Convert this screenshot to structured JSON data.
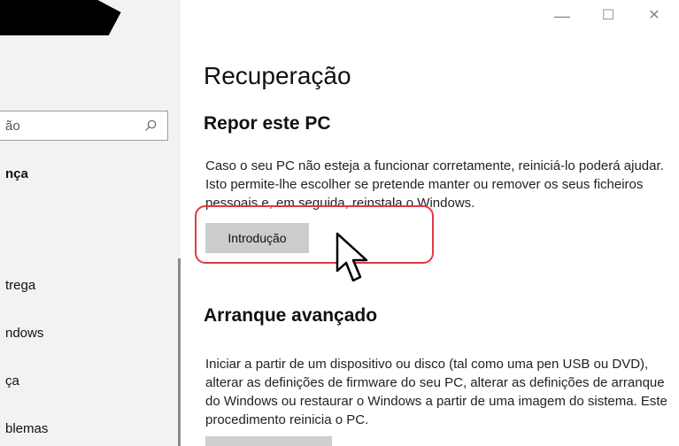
{
  "window": {
    "minimize": "—",
    "maximize": "☐",
    "close": "✕"
  },
  "sidebar": {
    "search_value": "ão",
    "items": [
      {
        "label": "nça",
        "bold": true
      },
      {
        "label": "trega"
      },
      {
        "label": "ndows"
      },
      {
        "label": "ça"
      },
      {
        "label": "blemas"
      }
    ]
  },
  "main": {
    "page_title": "Recuperação",
    "reset": {
      "heading": "Repor este PC",
      "description": "Caso o seu PC não esteja a funcionar corretamente, reiniciá-lo poderá ajudar. Isto permite-lhe escolher se pretende manter ou remover os seus ficheiros pessoais e, em seguida, reinstala o Windows.",
      "button_label": "Introdução"
    },
    "advanced": {
      "heading": "Arranque avançado",
      "description": "Iniciar a partir de um dispositivo ou disco (tal como uma pen USB ou DVD), alterar as definições de firmware do seu PC, alterar as definições de arranque do Windows ou restaurar o Windows a partir de uma imagem do sistema. Este procedimento reinicia o PC."
    }
  },
  "colors": {
    "highlight": "#e03a3e",
    "sidebar_bg": "#f2f2f2",
    "button_bg": "#cccccc"
  }
}
